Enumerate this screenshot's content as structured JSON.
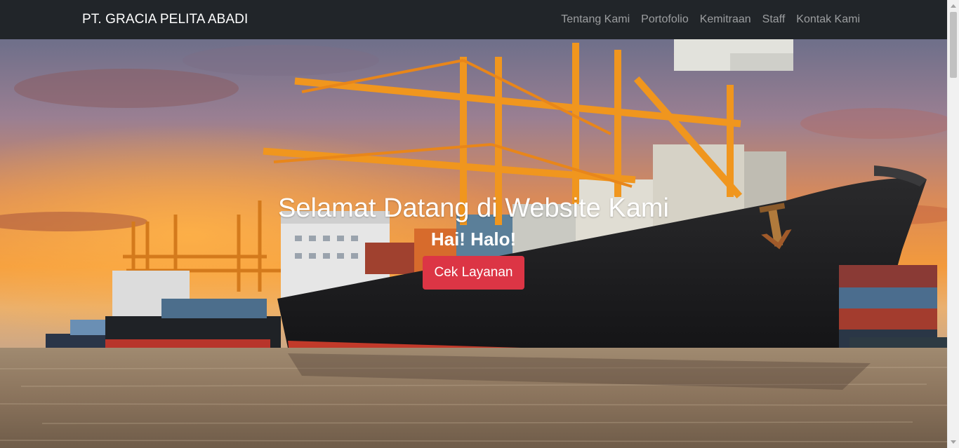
{
  "navbar": {
    "brand": "PT. GRACIA PELITA ABADI",
    "links": [
      {
        "label": "Tentang Kami"
      },
      {
        "label": "Portofolio"
      },
      {
        "label": "Kemitraan"
      },
      {
        "label": "Staff"
      },
      {
        "label": "Kontak Kami"
      }
    ]
  },
  "hero": {
    "title": "Selamat Datang di Website Kami",
    "subtitle": "Hai! Halo!",
    "button_label": "Cek Layanan",
    "background_image": "cargo-ship-port-sunset"
  },
  "colors": {
    "navbar_bg": "#212529",
    "button_bg": "#dc3545",
    "brand_text": "#ffffff",
    "link_text": "rgba(255,255,255,0.55)"
  }
}
